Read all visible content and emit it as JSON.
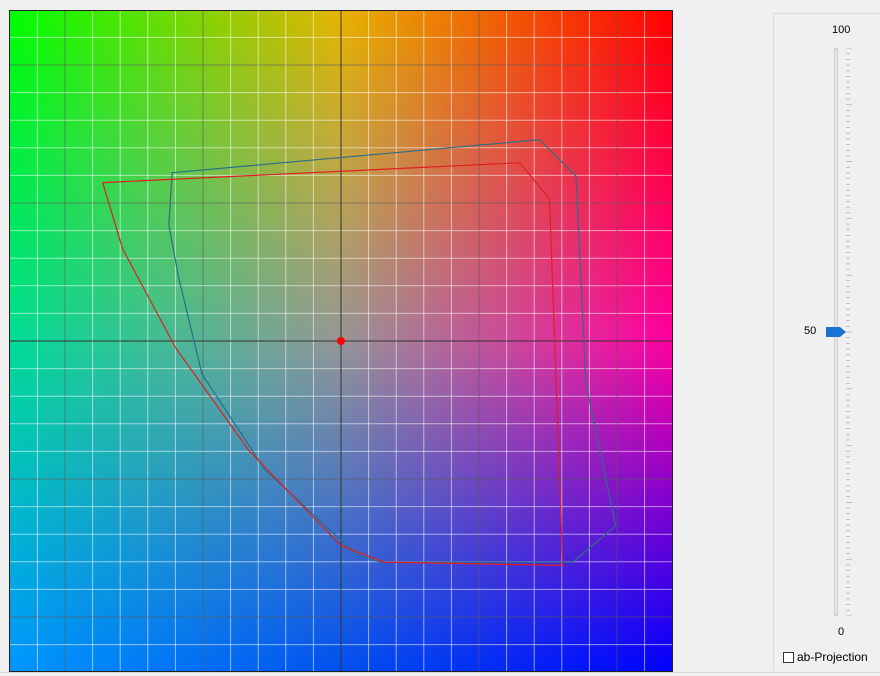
{
  "slider": {
    "max_label": "100",
    "value_label": "50",
    "min_label": "0",
    "min": 0,
    "max": 100,
    "value": 50,
    "thumb_color": "#1a73d0"
  },
  "projection": {
    "label": "ab-Projection",
    "checked": false
  },
  "chart_data": {
    "type": "scatter",
    "grid": true,
    "center_point": {
      "x": 0,
      "y": 0,
      "color": "#ff0000"
    },
    "series": [
      {
        "color": "#2a6f8a",
        "points": [
          [
            -0.51,
            0.51
          ],
          [
            0.6,
            0.61
          ],
          [
            0.71,
            0.5
          ],
          [
            0.74,
            -0.13
          ],
          [
            0.83,
            -0.56
          ],
          [
            0.7,
            -0.67
          ],
          [
            0.12,
            -0.67
          ],
          [
            0.05,
            -0.65
          ],
          [
            -0.23,
            -0.39
          ],
          [
            -0.42,
            -0.1
          ],
          [
            -0.49,
            0.19
          ],
          [
            -0.52,
            0.35
          ]
        ]
      },
      {
        "color": "#e02020",
        "points": [
          [
            -0.72,
            0.48
          ],
          [
            0.54,
            0.54
          ],
          [
            0.63,
            0.43
          ],
          [
            0.67,
            -0.68
          ],
          [
            0.13,
            -0.67
          ],
          [
            0.0,
            -0.62
          ],
          [
            -0.28,
            -0.33
          ],
          [
            -0.5,
            -0.02
          ],
          [
            -0.66,
            0.28
          ]
        ]
      }
    ]
  }
}
